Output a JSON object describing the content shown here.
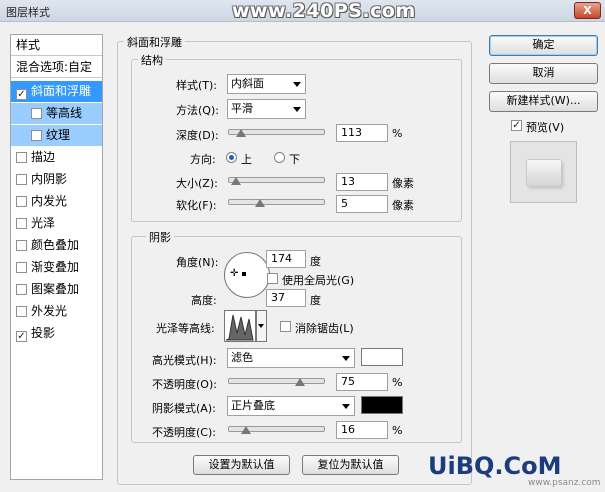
{
  "window": {
    "title": "图层样式",
    "close_label": "X",
    "watermark": "www.240PS.com"
  },
  "styles_list": {
    "header": "样式",
    "blend_options": "混合选项:自定",
    "items": [
      {
        "label": "斜面和浮雕",
        "checked": true
      },
      {
        "label": "等高线",
        "checked": false
      },
      {
        "label": "纹理",
        "checked": false
      },
      {
        "label": "描边",
        "checked": false
      },
      {
        "label": "内阴影",
        "checked": false
      },
      {
        "label": "内发光",
        "checked": false
      },
      {
        "label": "光泽",
        "checked": false
      },
      {
        "label": "颜色叠加",
        "checked": false
      },
      {
        "label": "渐变叠加",
        "checked": false
      },
      {
        "label": "图案叠加",
        "checked": false
      },
      {
        "label": "外发光",
        "checked": false
      },
      {
        "label": "投影",
        "checked": true
      }
    ]
  },
  "bevel": {
    "section_title": "斜面和浮雕",
    "structure": {
      "title": "结构",
      "style_label": "样式(T):",
      "style_value": "内斜面",
      "technique_label": "方法(Q):",
      "technique_value": "平滑",
      "depth_label": "深度(D):",
      "depth_value": "113",
      "depth_unit": "%",
      "depth_pct": 0.113,
      "direction_label": "方向:",
      "dir_up": "上",
      "dir_down": "下",
      "size_label": "大小(Z):",
      "size_value": "13",
      "size_unit": "像素",
      "size_pct": 0.053,
      "soften_label": "软化(F):",
      "soften_value": "5",
      "soften_unit": "像素",
      "soften_pct": 0.31
    },
    "shading": {
      "title": "阴影",
      "angle_label": "角度(N):",
      "angle_value": "174",
      "angle_unit": "度",
      "global_light_label": "使用全局光(G)",
      "altitude_label": "高度:",
      "altitude_value": "37",
      "altitude_unit": "度",
      "gloss_label": "光泽等高线:",
      "antialias_label": "消除锯齿(L)",
      "highlight_mode_label": "高光模式(H):",
      "highlight_mode_value": "滤色",
      "highlight_color": "#ffffff",
      "hl_opacity_label": "不透明度(O):",
      "hl_opacity_value": "75",
      "hl_opacity_unit": "%",
      "hl_opacity_pct": 0.75,
      "shadow_mode_label": "阴影模式(A):",
      "shadow_mode_value": "正片叠底",
      "shadow_color": "#000000",
      "sh_opacity_label": "不透明度(C):",
      "sh_opacity_value": "16",
      "sh_opacity_unit": "%",
      "sh_opacity_pct": 0.16
    },
    "make_default": "设置为默认值",
    "reset_default": "复位为默认值"
  },
  "buttons": {
    "ok": "确定",
    "cancel": "取消",
    "new_style": "新建样式(W)...",
    "preview": "预览(V)"
  },
  "branding": {
    "logo": "UiBQ.CoM",
    "site": "www.psanz.com"
  }
}
